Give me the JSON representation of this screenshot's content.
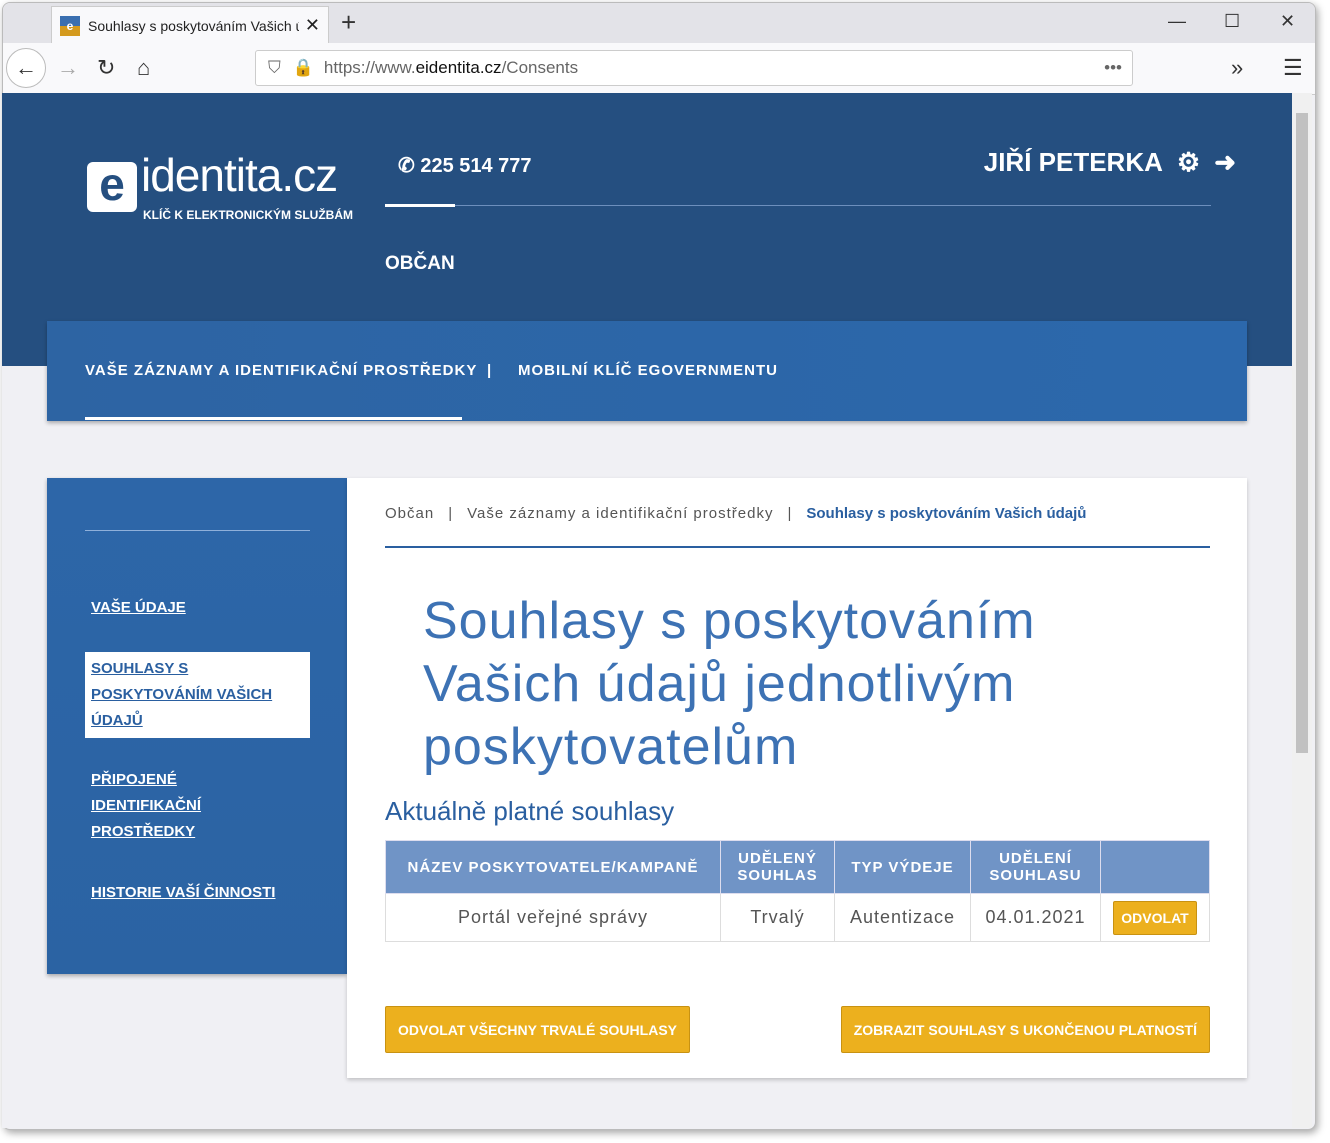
{
  "browser": {
    "tab_title": "Souhlasy s poskytováním Vašich údajů",
    "url_prefix": "https://www.",
    "url_domain": "eidentita.cz",
    "url_path": "/Consents"
  },
  "header": {
    "logo_text": "identita.cz",
    "logo_sub": "KLÍČ K ELEKTRONICKÝM SLUŽBÁM",
    "phone": "225 514 777",
    "user": "JIŘÍ PETERKA",
    "section": "OBČAN"
  },
  "topnav": [
    "VAŠE ZÁZNAMY A IDENTIFIKAČNÍ PROSTŘEDKY",
    "|",
    "MOBILNÍ KLÍČ EGOVERNMENTU"
  ],
  "sidebar": [
    "VAŠE ÚDAJE",
    "SOUHLASY S POSKYTOVÁNÍM VAŠICH ÚDAJŮ",
    "PŘIPOJENÉ IDENTIFIKAČNÍ PROSTŘEDKY",
    "HISTORIE VAŠÍ ČINNOSTI"
  ],
  "breadcrumb": [
    "Občan",
    "Vaše záznamy a identifikační prostředky",
    "Souhlasy s poskytováním Vašich údajů"
  ],
  "title": "Souhlasy s poskytováním Vašich údajů jednotlivým poskytovatelům",
  "subtitle": "Aktuálně platné souhlasy",
  "table": {
    "headers": [
      "NÁZEV POSKYTOVATELE/KAMPANĚ",
      "UDĚLENÝ SOUHLAS",
      "TYP VÝDEJE",
      "UDĚLENÍ SOUHLASU",
      ""
    ],
    "rows": [
      {
        "provider": "Portál veřejné správy",
        "consent": "Trvalý",
        "type": "Autentizace",
        "date": "04.01.2021",
        "action": "ODVOLAT"
      }
    ]
  },
  "buttons": {
    "revoke_all": "ODVOLAT VŠECHNY TRVALÉ SOUHLASY",
    "show_expired": "ZOBRAZIT SOUHLASY S UKONČENOU PLATNOSTÍ"
  }
}
